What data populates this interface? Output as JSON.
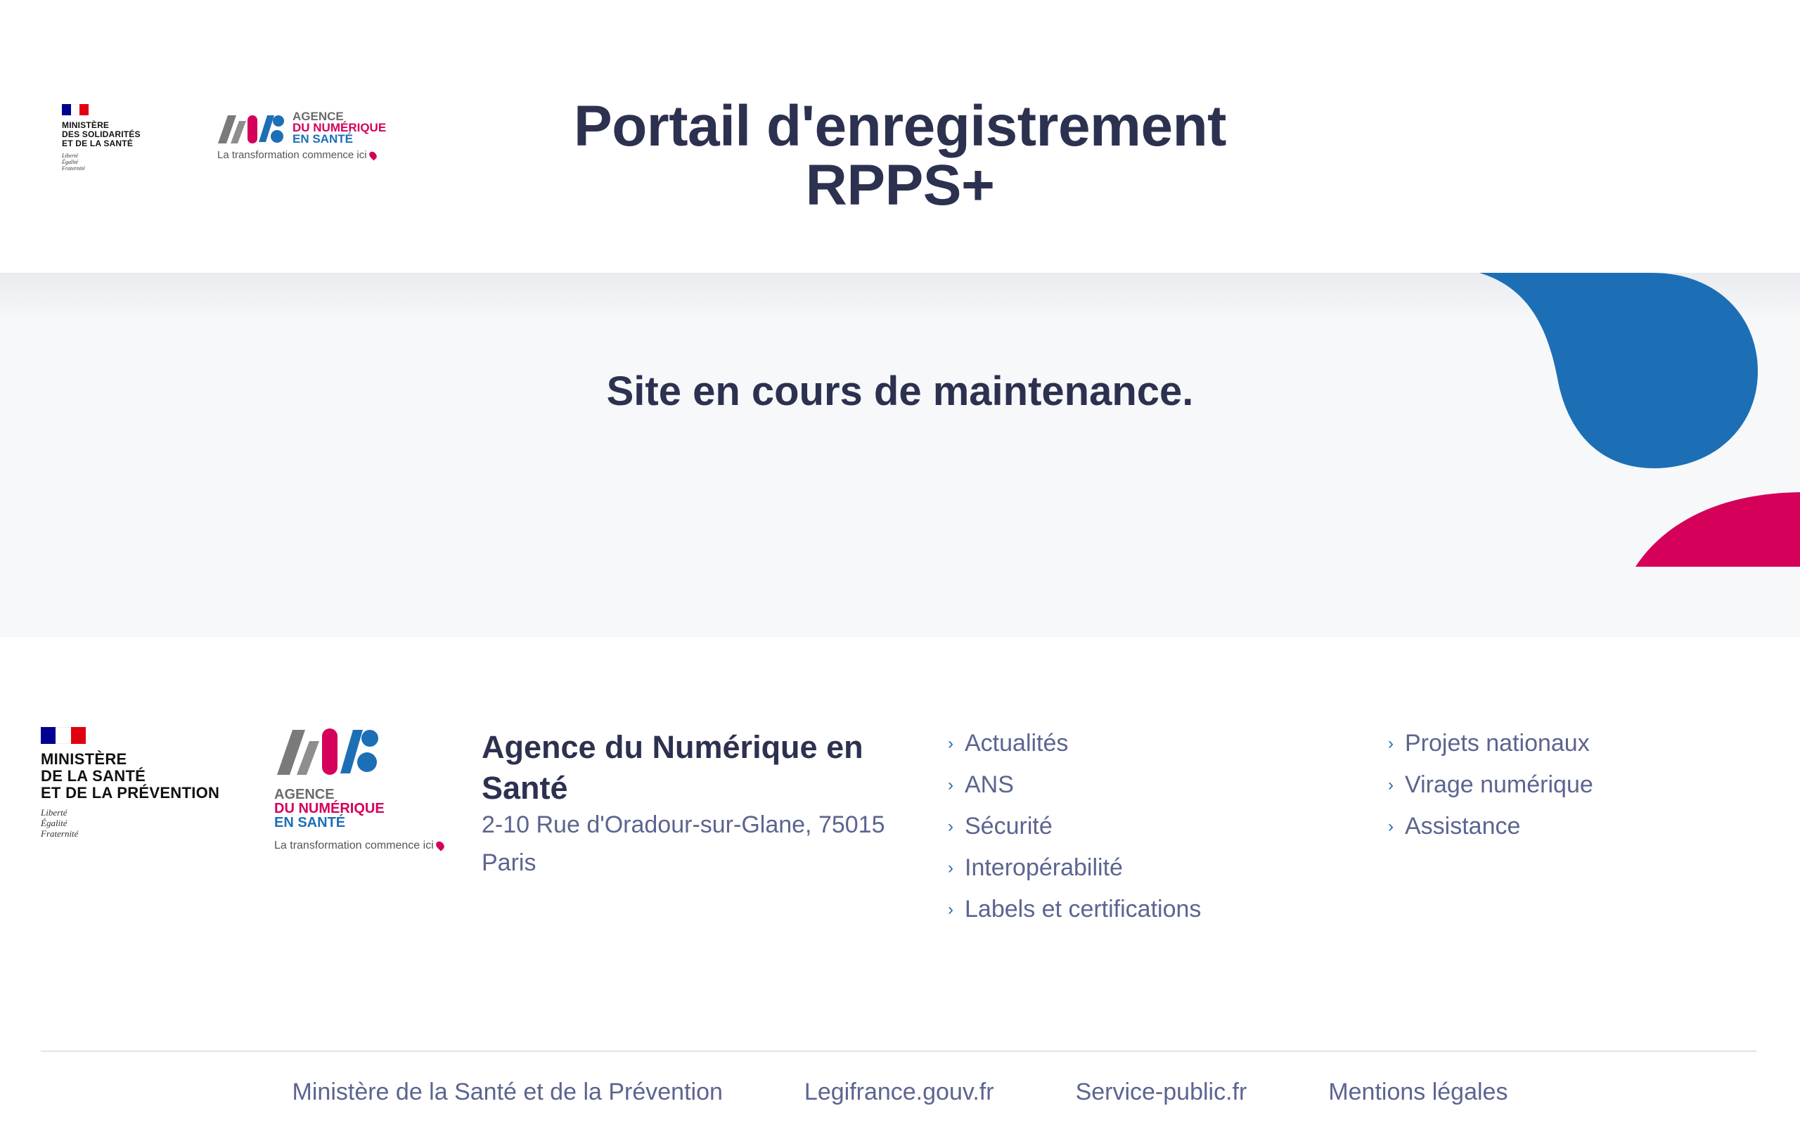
{
  "header": {
    "ministry_small": {
      "name_lines": [
        "MINISTÈRE",
        "DES SOLIDARITÉS",
        "ET DE LA SANTÉ"
      ],
      "motto": [
        "Liberté",
        "Égalité",
        "Fraternité"
      ]
    },
    "ans_logo": {
      "lines": [
        "AGENCE",
        "DU NUMÉRIQUE",
        "EN SANTÉ"
      ],
      "tagline": "La transformation commence ici"
    },
    "title_line1": "Portail d'enregistrement",
    "title_line2": "RPPS+"
  },
  "main": {
    "message": "Site en cours de maintenance."
  },
  "footer": {
    "ministry": {
      "name_lines": [
        "MINISTÈRE",
        "DE LA SANTÉ",
        "ET DE LA PRÉVENTION"
      ],
      "motto": [
        "Liberté",
        "Égalité",
        "Fraternité"
      ]
    },
    "ans_logo": {
      "lines": [
        "AGENCE",
        "DU NUMÉRIQUE",
        "EN SANTÉ"
      ],
      "tagline": "La transformation commence ici"
    },
    "agency_name": "Agence du Numérique en Santé",
    "address_line1": "2-10 Rue d'Oradour-sur-Glane, 75015",
    "address_line2": "Paris",
    "links_col1": [
      "Actualités",
      "ANS",
      "Sécurité",
      "Interopérabilité",
      "Labels et certifications"
    ],
    "links_col2": [
      "Projets nationaux",
      "Virage numérique",
      "Assistance"
    ],
    "bottom_links": [
      "Ministère de la Santé et de la Prévention",
      "Legifrance.gouv.fr",
      "Service-public.fr",
      "Mentions légales"
    ]
  },
  "colors": {
    "navy_text": "#2d3150",
    "muted_text": "#5c6490",
    "blue": "#1d6fb5",
    "pink": "#d5005a",
    "band_bg": "#f7f8fa"
  },
  "icons": {
    "link_chevron": "chevron-right-icon"
  }
}
